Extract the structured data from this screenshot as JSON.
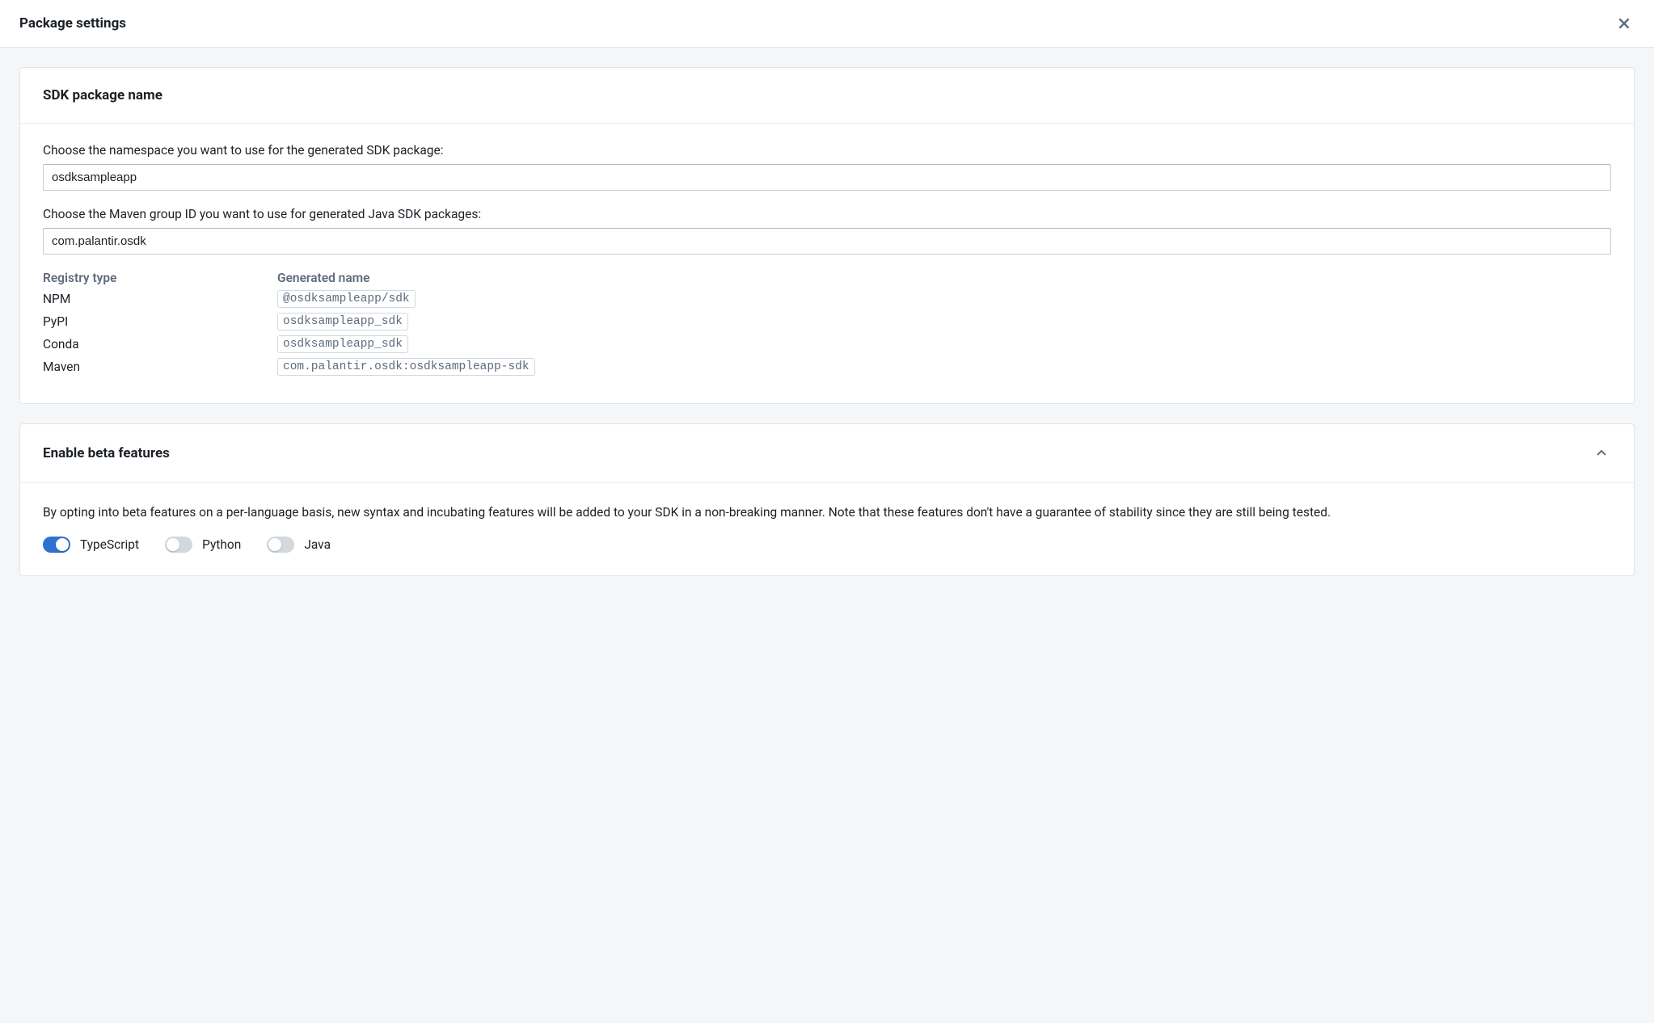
{
  "header": {
    "title": "Package settings"
  },
  "sdk_card": {
    "title": "SDK package name",
    "namespace_label": "Choose the namespace you want to use for the generated SDK package:",
    "namespace_value": "osdksampleapp",
    "maven_label": "Choose the Maven group ID you want to use for generated Java SDK packages:",
    "maven_value": "com.palantir.osdk",
    "col_registry": "Registry type",
    "col_generated": "Generated name",
    "rows": [
      {
        "registry": "NPM",
        "generated": "@osdksampleapp/sdk"
      },
      {
        "registry": "PyPI",
        "generated": "osdksampleapp_sdk"
      },
      {
        "registry": "Conda",
        "generated": "osdksampleapp_sdk"
      },
      {
        "registry": "Maven",
        "generated": "com.palantir.osdk:osdksampleapp-sdk"
      }
    ]
  },
  "beta_card": {
    "title": "Enable beta features",
    "description": "By opting into beta features on a per-language basis, new syntax and incubating features will be added to your SDK in a non-breaking manner. Note that these features don't have a guarantee of stability since they are still being tested.",
    "toggles": [
      {
        "label": "TypeScript",
        "on": true
      },
      {
        "label": "Python",
        "on": false
      },
      {
        "label": "Java",
        "on": false
      }
    ]
  }
}
